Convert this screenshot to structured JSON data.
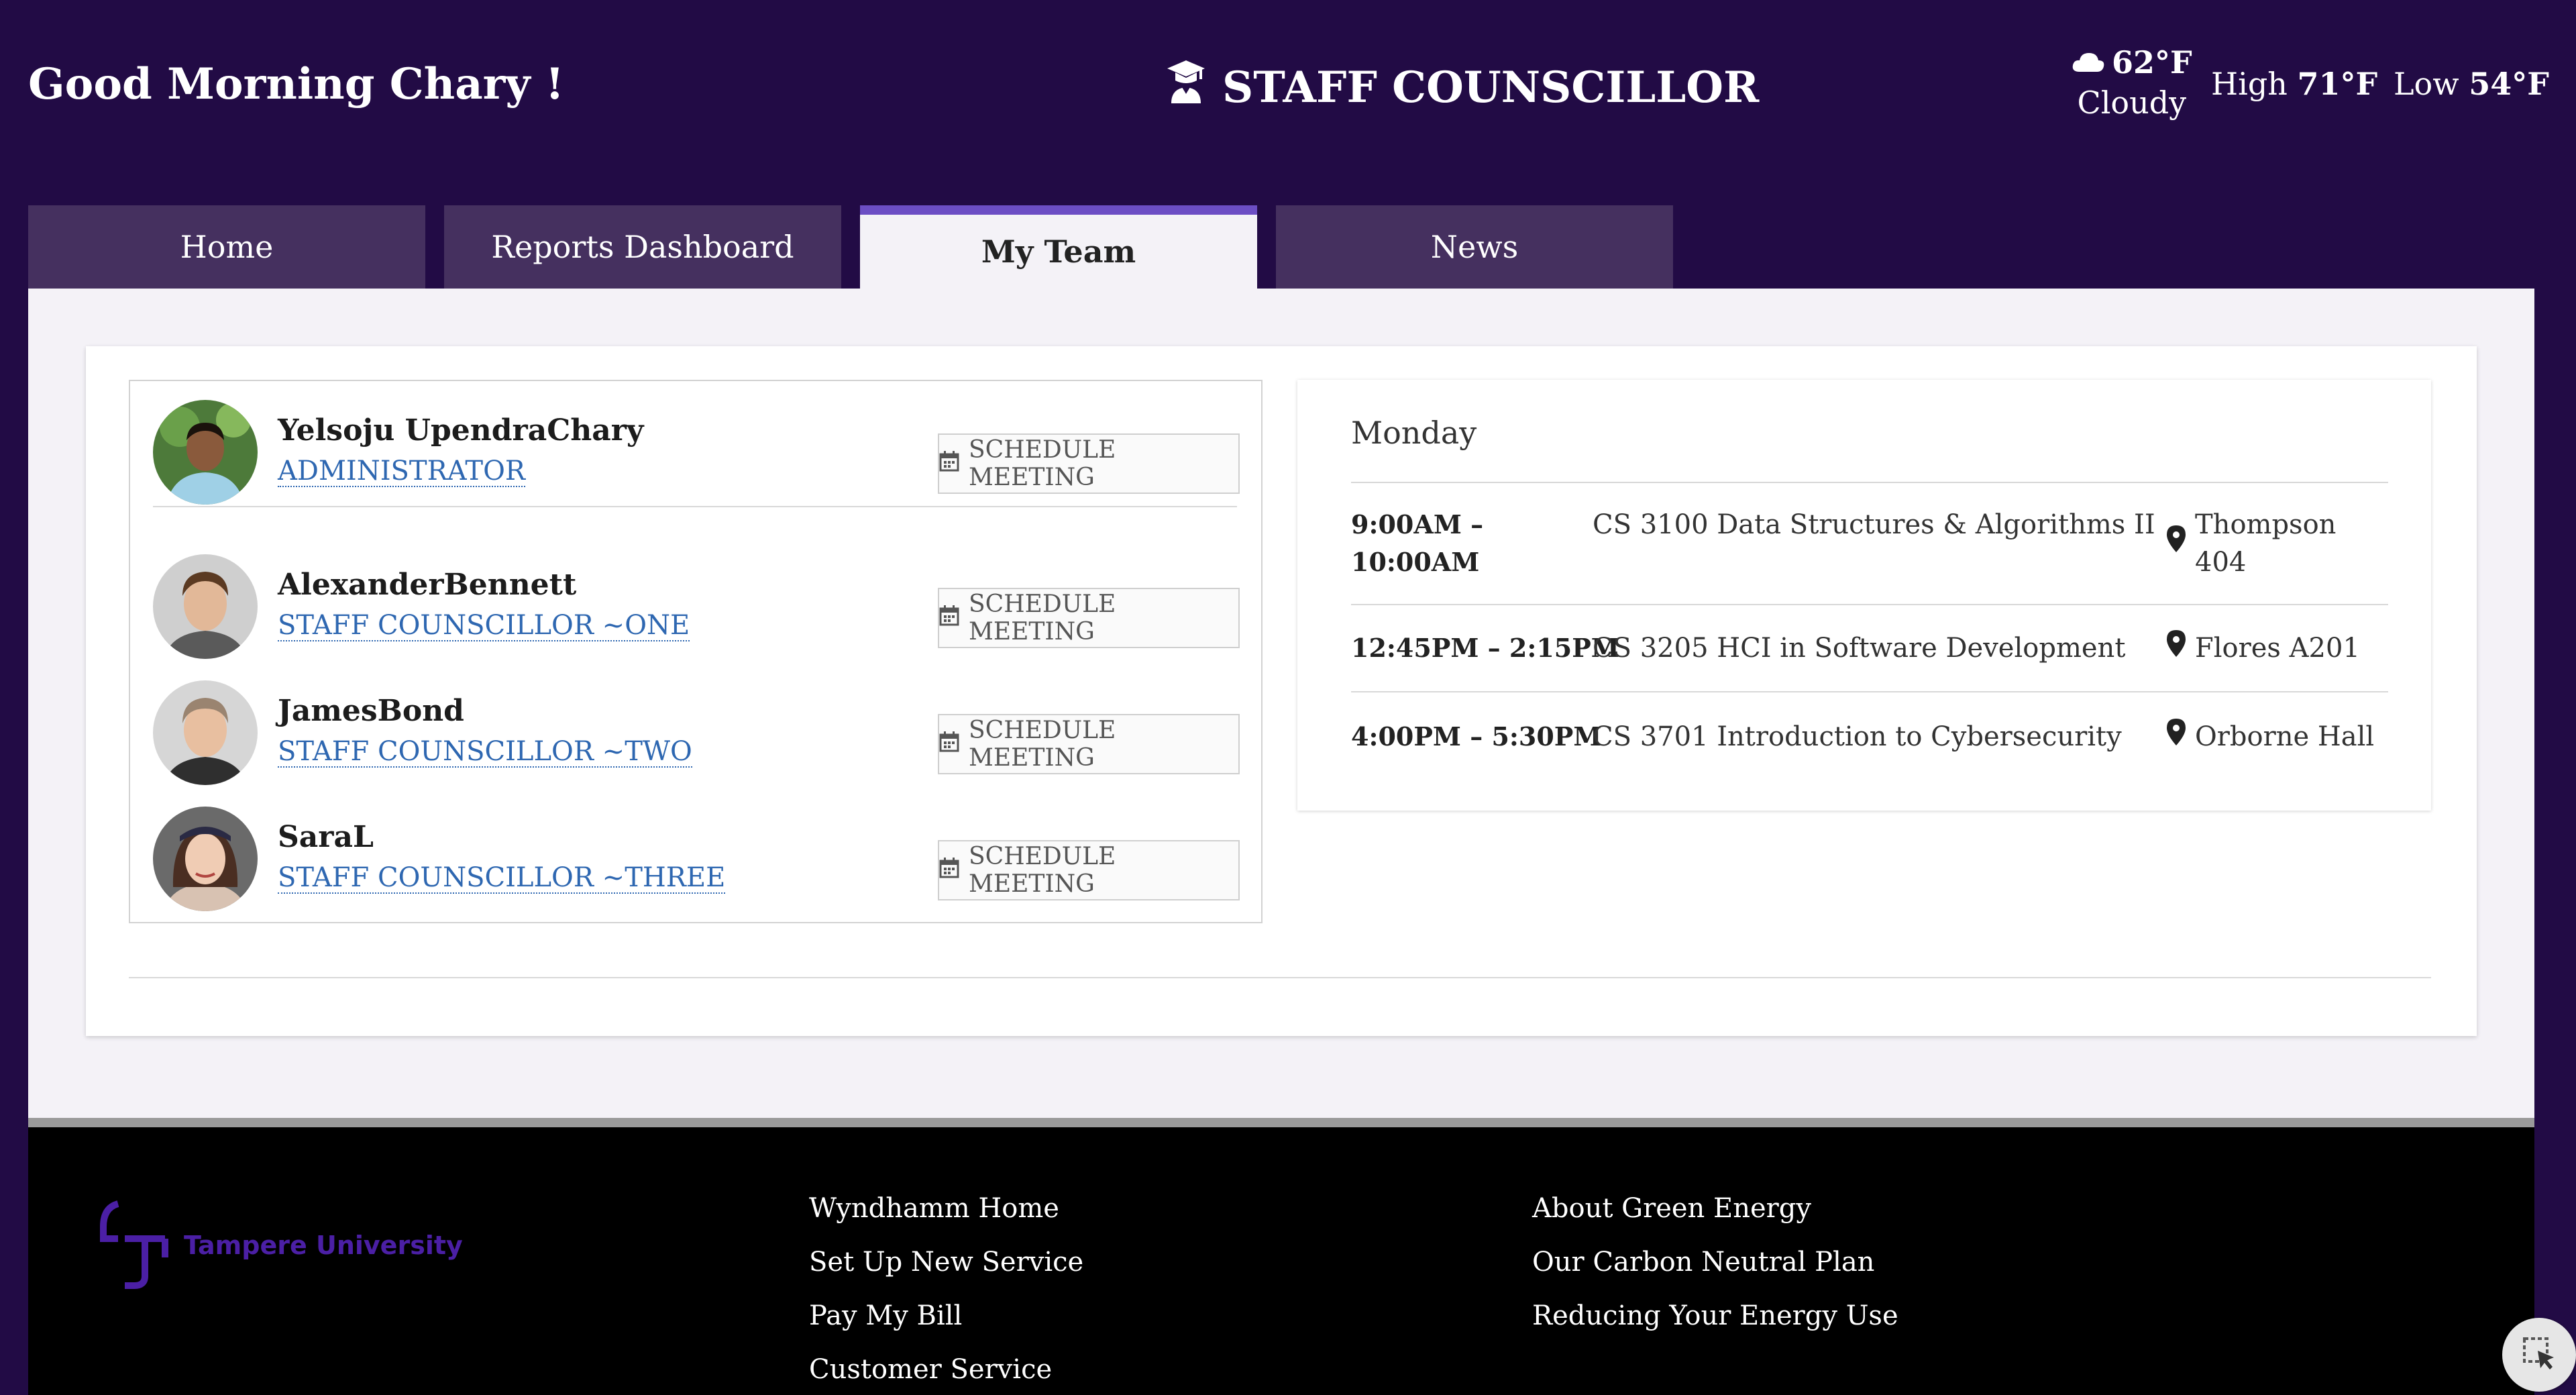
{
  "header": {
    "greeting": "Good Morning Chary !",
    "title": "STAFF COUNSCILLOR",
    "title_icon": "graduate-icon",
    "weather": {
      "icon": "cloud-icon",
      "current_temp": "62°F",
      "condition": "Cloudy",
      "high_label": "High",
      "high_value": "71°F",
      "low_label": "Low",
      "low_value": "54°F"
    }
  },
  "tabs": [
    {
      "label": "Home",
      "active": false
    },
    {
      "label": "Reports Dashboard",
      "active": false
    },
    {
      "label": "My Team",
      "active": true
    },
    {
      "label": "News",
      "active": false
    }
  ],
  "team": [
    {
      "name": "Yelsoju UpendraChary",
      "role": "ADMINISTRATOR",
      "action": "SCHEDULE MEETING"
    },
    {
      "name": "AlexanderBennett",
      "role": "STAFF COUNSCILLOR ~ONE",
      "action": "SCHEDULE MEETING"
    },
    {
      "name": "JamesBond",
      "role": "STAFF COUNSCILLOR ~TWO",
      "action": "SCHEDULE MEETING"
    },
    {
      "name": "SaraL",
      "role": "STAFF COUNSCILLOR ~THREE",
      "action": "SCHEDULE MEETING"
    }
  ],
  "schedule": {
    "day": "Monday",
    "rows": [
      {
        "time_line1": "9:00AM –",
        "time_line2": "10:00AM",
        "course": "CS 3100 Data Structures & Algorithms II",
        "location": "Thompson 404"
      },
      {
        "time_line1": "12:45PM – 2:15PM",
        "time_line2": "",
        "course": "CS 3205 HCI in Software Development",
        "location": "Flores A201"
      },
      {
        "time_line1": "4:00PM – 5:30PM",
        "time_line2": "",
        "course": "CS 3701 Introduction to Cybersecurity",
        "location": "Orborne Hall"
      }
    ]
  },
  "footer": {
    "logo_text": "Tampere University",
    "links_col1": [
      "Wyndhamm Home",
      "Set Up New Service",
      "Pay My Bill",
      "Customer Service"
    ],
    "links_col2": [
      "About Green Energy",
      "Our Carbon Neutral Plan",
      "Reducing Your Energy Use"
    ]
  },
  "colors": {
    "header_bg": "#220b45",
    "tab_bg": "#45305f",
    "tab_active_border": "#6c4ec4",
    "link": "#2e67b1",
    "footer_bg": "#000000",
    "logo": "#4b1fa5"
  }
}
